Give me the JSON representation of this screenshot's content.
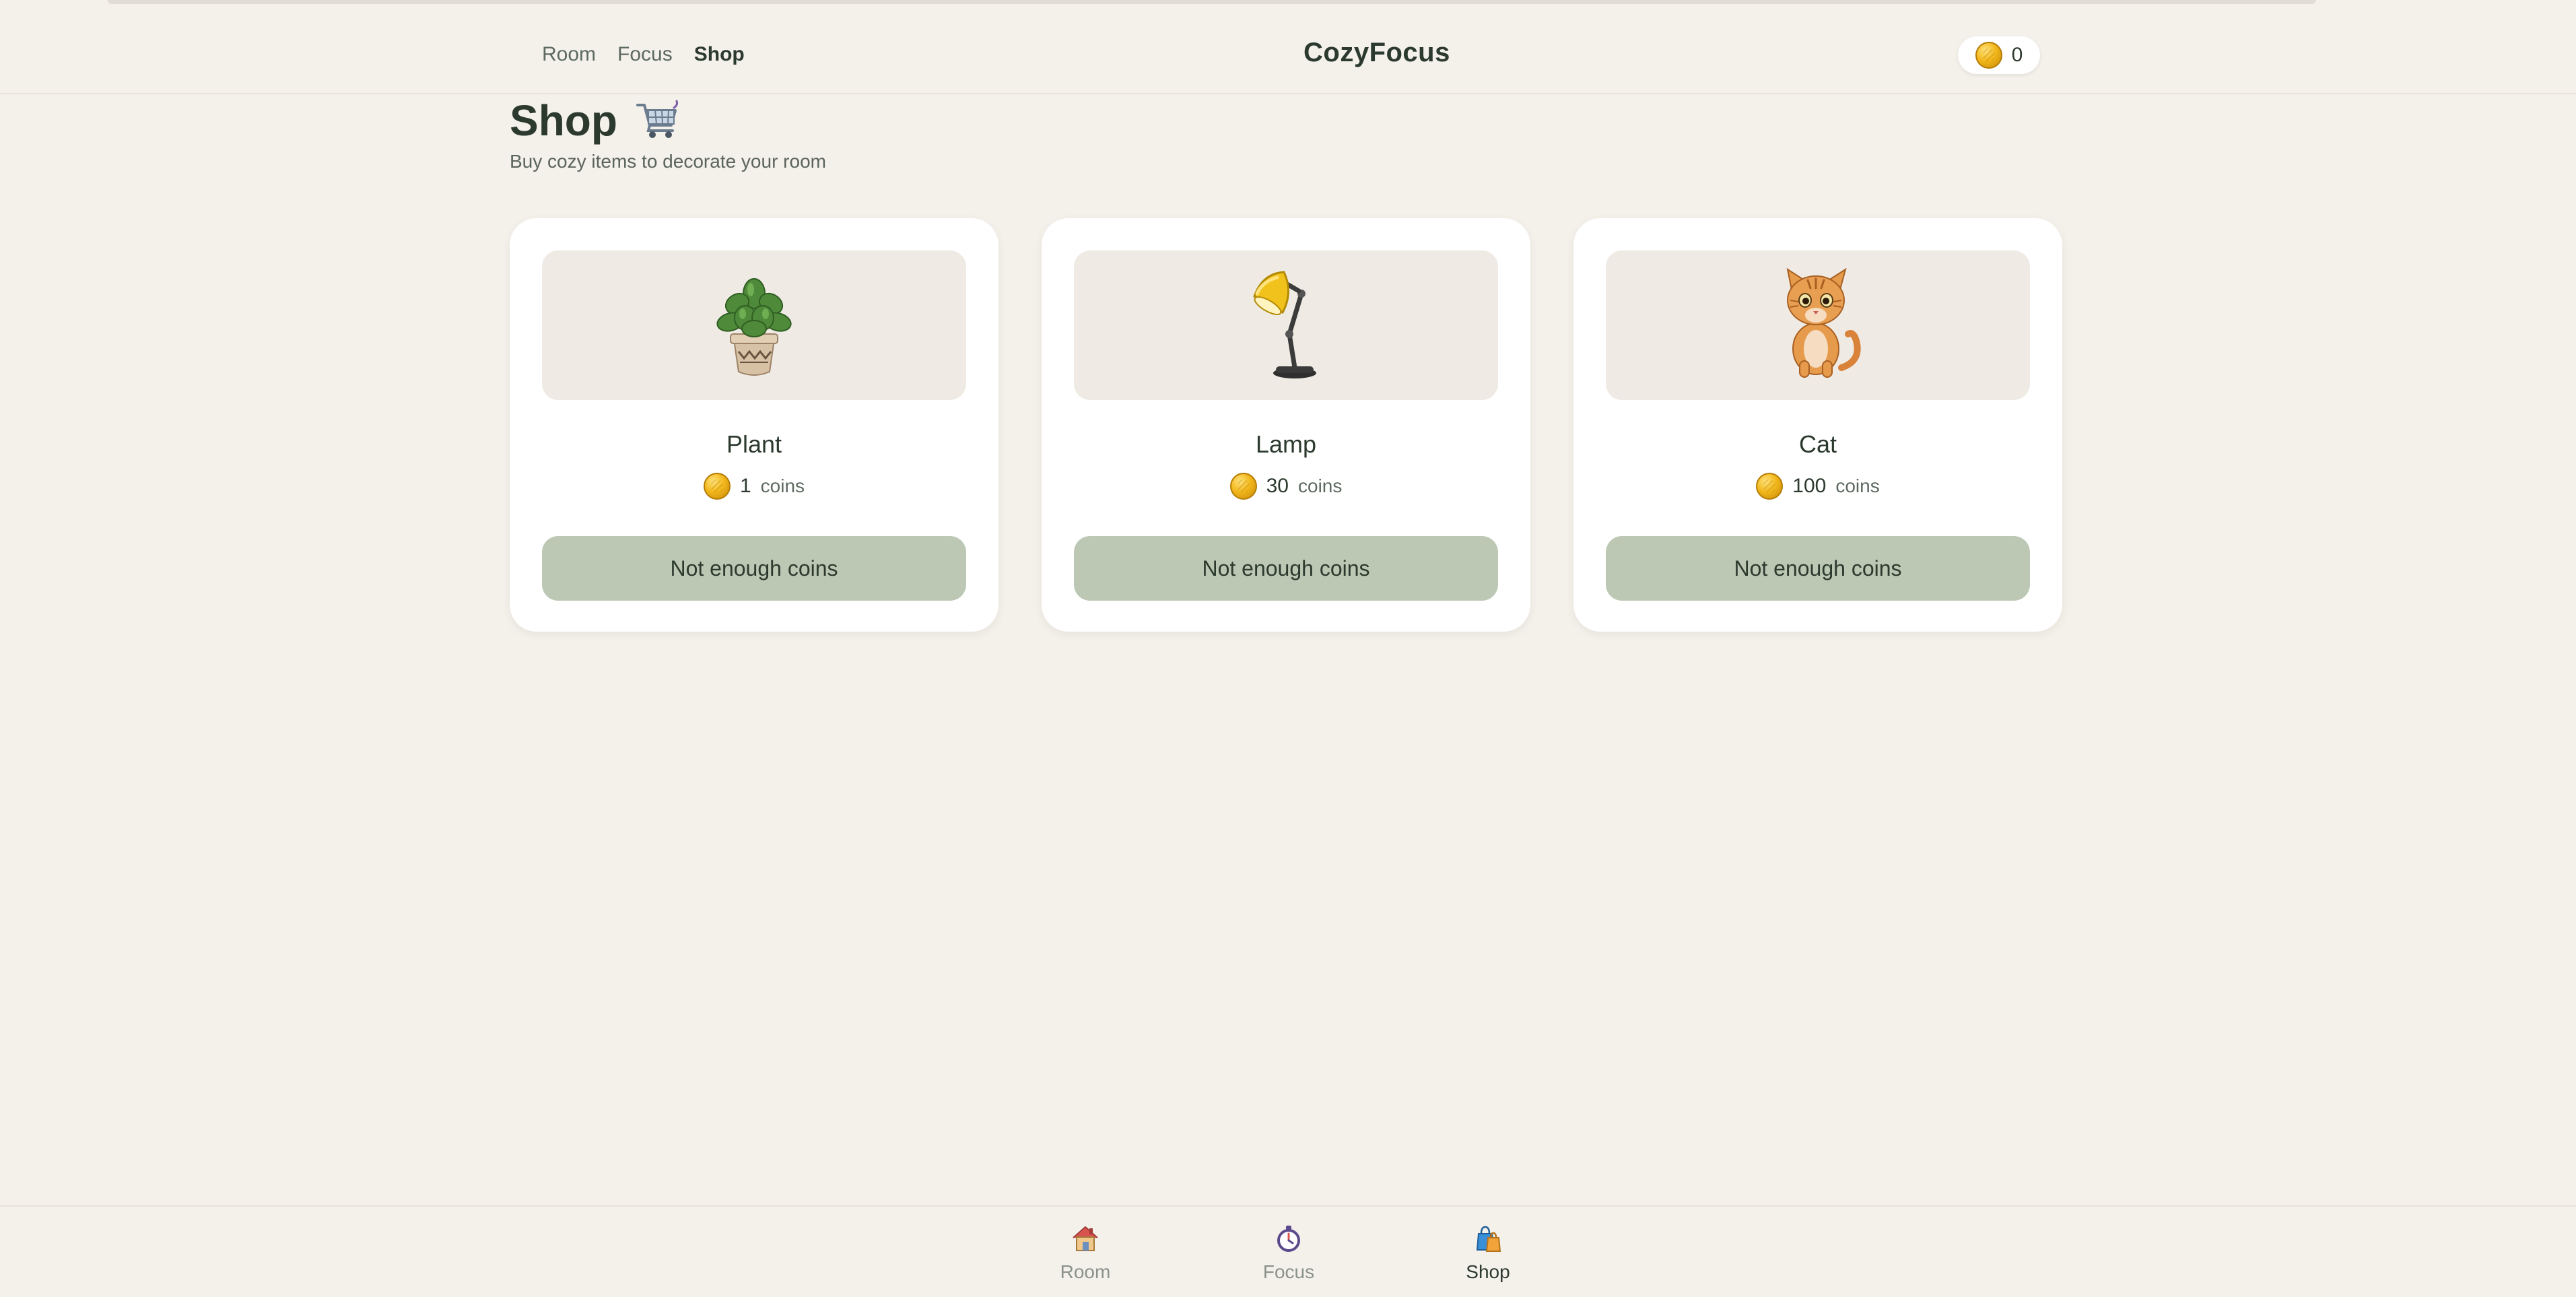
{
  "header": {
    "nav": [
      {
        "label": "Room",
        "active": false
      },
      {
        "label": "Focus",
        "active": false
      },
      {
        "label": "Shop",
        "active": true
      }
    ],
    "brand": "CozyFocus",
    "coin_balance": "0",
    "coin_icon": "coin-icon"
  },
  "page": {
    "title": "Shop",
    "title_icon": "shopping-cart-icon",
    "subtitle": "Buy cozy items to decorate your room"
  },
  "shop_items": [
    {
      "name": "Plant",
      "price": "1",
      "unit": "coins",
      "button_label": "Not enough coins",
      "icon": "potted-plant-icon"
    },
    {
      "name": "Lamp",
      "price": "30",
      "unit": "coins",
      "button_label": "Not enough coins",
      "icon": "desk-lamp-icon"
    },
    {
      "name": "Cat",
      "price": "100",
      "unit": "coins",
      "button_label": "Not enough coins",
      "icon": "cat-icon"
    }
  ],
  "bottom_nav": [
    {
      "label": "Room",
      "icon": "house-icon",
      "active": false
    },
    {
      "label": "Focus",
      "icon": "stopwatch-icon",
      "active": false
    },
    {
      "label": "Shop",
      "icon": "shopping-bags-icon",
      "active": true
    }
  ],
  "colors": {
    "background": "#f4f0ea",
    "card": "#ffffff",
    "card_art_bg": "#efebe4",
    "disabled_button": "#bcc7b4",
    "text_dark": "#2c3a2e",
    "coin_gold": "#f2b81c"
  }
}
